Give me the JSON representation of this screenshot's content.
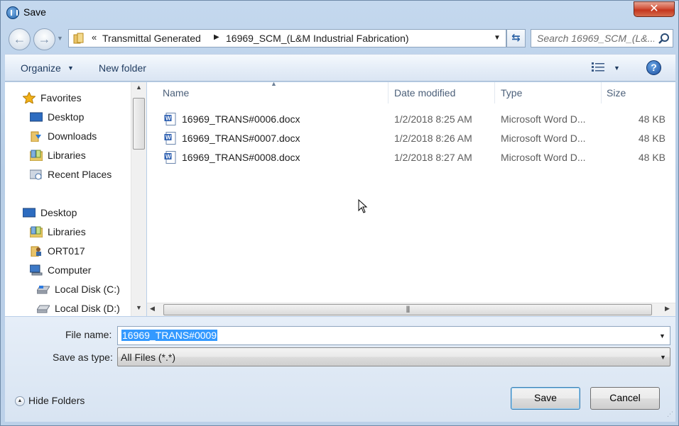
{
  "window": {
    "title": "Save",
    "close_glyph": "✕"
  },
  "address": {
    "chevron": "«",
    "segments": [
      "Transmittal Generated",
      "16969_SCM_(L&M Industrial Fabrication)"
    ],
    "search_placeholder": "Search 16969_SCM_(L&..."
  },
  "toolbar": {
    "organize_label": "Organize",
    "new_folder_label": "New folder",
    "help_glyph": "?"
  },
  "nav": {
    "items": [
      {
        "label": "Favorites",
        "icon": "star-icon"
      },
      {
        "label": "Desktop",
        "icon": "desktop-icon"
      },
      {
        "label": "Downloads",
        "icon": "downloads-icon"
      },
      {
        "label": "Libraries",
        "icon": "libraries-icon"
      },
      {
        "label": "Recent Places",
        "icon": "recent-places-icon"
      },
      {
        "label": "Desktop",
        "icon": "desktop-icon"
      },
      {
        "label": "Libraries",
        "icon": "libraries-icon"
      },
      {
        "label": "ORT017",
        "icon": "user-folder-icon"
      },
      {
        "label": "Computer",
        "icon": "computer-icon"
      },
      {
        "label": "Local Disk (C:)",
        "icon": "drive-icon"
      },
      {
        "label": "Local Disk (D:)",
        "icon": "drive-icon"
      }
    ]
  },
  "files": {
    "columns": [
      "Name",
      "Date modified",
      "Type",
      "Size"
    ],
    "rows": [
      {
        "name": "16969_TRANS#0006.docx",
        "date": "1/2/2018 8:25 AM",
        "type": "Microsoft Word D...",
        "size": "48 KB"
      },
      {
        "name": "16969_TRANS#0007.docx",
        "date": "1/2/2018 8:26 AM",
        "type": "Microsoft Word D...",
        "size": "48 KB"
      },
      {
        "name": "16969_TRANS#0008.docx",
        "date": "1/2/2018 8:27 AM",
        "type": "Microsoft Word D...",
        "size": "48 KB"
      }
    ]
  },
  "form": {
    "file_name_label": "File name:",
    "file_name_value": "16969_TRANS#0009",
    "save_type_label": "Save as type:",
    "save_type_value": "All Files (*.*)"
  },
  "footer": {
    "hide_folders_label": "Hide Folders",
    "save_label": "Save",
    "cancel_label": "Cancel"
  },
  "colors": {
    "selection": "#3399ff",
    "accent": "#1c4fa0",
    "close": "#c4361e"
  }
}
